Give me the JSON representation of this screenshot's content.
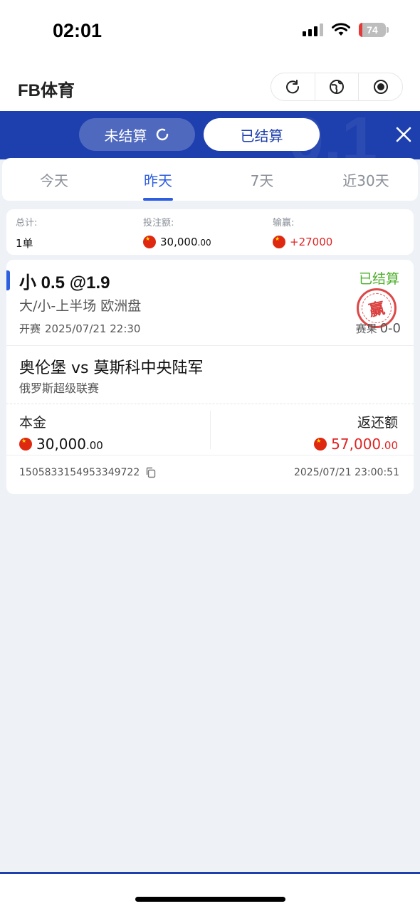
{
  "status_bar": {
    "time": "02:01",
    "battery": "74"
  },
  "app": {
    "title": "FB体育"
  },
  "header_actions": [
    "refresh-icon",
    "globe-icon",
    "record-icon"
  ],
  "settle_tabs": {
    "unsettled": "未结算",
    "settled": "已结算",
    "active": "settled"
  },
  "date_tabs": {
    "items": [
      "今天",
      "昨天",
      "7天",
      "近30天"
    ],
    "active_index": 1
  },
  "summary": {
    "total_label": "总计:",
    "total_value": "1单",
    "stake_label": "投注额:",
    "stake_value": "30,000",
    "stake_decimals": ".00",
    "winloss_label": "输赢:",
    "winloss_value": "+27000"
  },
  "bet": {
    "selection": "小 0.5 @1.9",
    "status": "已结算",
    "stamp_text": "赢",
    "market": "大/小-上半场 欧洲盘",
    "kickoff_label": "开赛",
    "kickoff_time": "2025/07/21 22:30",
    "score_label": "赛果",
    "score_value": "0-0",
    "match": "奥伦堡 vs 莫斯科中央陆军",
    "league": "俄罗斯超级联赛",
    "stake_label": "本金",
    "stake_value": "30,000",
    "stake_decimals": ".00",
    "payout_label": "返还额",
    "payout_value": "57,000",
    "payout_decimals": ".00",
    "bet_id": "1505833154953349722",
    "settled_time": "2025/07/21 23:00:51"
  },
  "colors": {
    "brand_blue": "#1e3fae",
    "accent_blue": "#2d5de0",
    "win_red": "#e02424",
    "settled_green": "#4caf2a"
  }
}
